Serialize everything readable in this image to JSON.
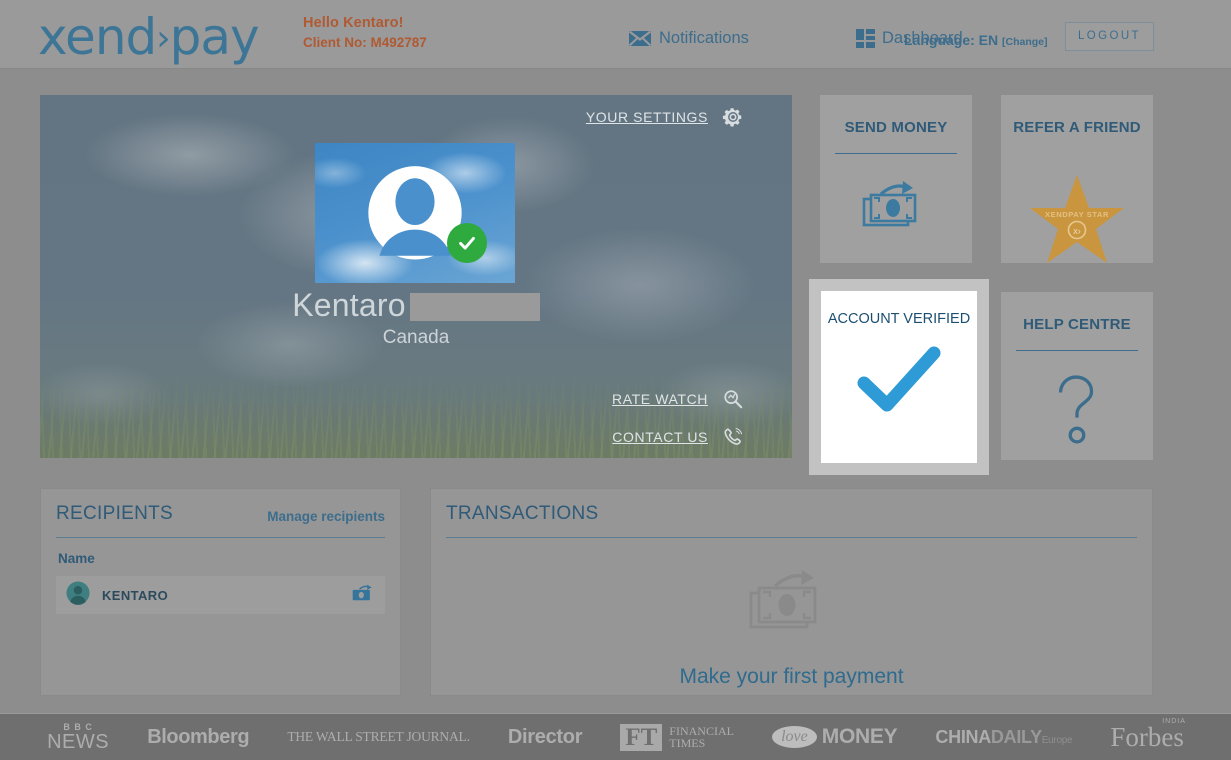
{
  "header": {
    "logo_text": "xend",
    "logo_chevron": "›",
    "logo_text2": "pay",
    "greeting": "Hello Kentaro!",
    "client_no": "Client No: M492787",
    "nav": [
      {
        "label": "Notifications",
        "icon": "envelope-icon"
      },
      {
        "label": "Dashboard",
        "icon": "dashboard-grid-icon"
      }
    ],
    "language_label": "Language: EN",
    "language_change": "[Change]",
    "logout_label": "LOGOUT"
  },
  "hero": {
    "settings_label": "YOUR SETTINGS",
    "settings_icon": "gear-icon",
    "profile_name": "Kentaro",
    "profile_name_redacted": "",
    "profile_country": "Canada",
    "avatar_icon": "user-silhouette-icon",
    "verified_badge_icon": "green-check-badge-icon",
    "links": [
      {
        "label": "RATE WATCH",
        "icon": "magnifier-icon"
      },
      {
        "label": "CONTACT US",
        "icon": "phone-icon"
      }
    ]
  },
  "tiles": {
    "send_money": {
      "title": "SEND MONEY",
      "icon": "banknote-arrow-icon"
    },
    "refer_friend": {
      "title": "REFER A FRIEND",
      "icon": "star-icon",
      "star_text": "XENDPAY STAR",
      "star_mark": "x›"
    },
    "account_verified": {
      "title": "ACCOUNT VERIFIED",
      "icon": "blue-checkmark-icon"
    },
    "help_centre": {
      "title": "HELP CENTRE",
      "icon": "question-mark-icon"
    }
  },
  "recipients": {
    "title": "RECIPIENTS",
    "manage_link": "Manage recipients",
    "columns": [
      "Name"
    ],
    "rows": [
      {
        "name": "KENTARO",
        "avatar_icon": "contact-avatar-icon",
        "action_icon": "send-money-small-icon"
      }
    ]
  },
  "transactions": {
    "title": "TRANSACTIONS",
    "empty_icon": "banknote-arrow-icon",
    "empty_cta": "Make your first payment"
  },
  "footer": {
    "press": [
      {
        "name": "bbc-news-logo",
        "line1": "B B C",
        "line2": "NEWS"
      },
      {
        "name": "bloomberg-logo",
        "text": "Bloomberg"
      },
      {
        "name": "wall-street-journal-logo",
        "text": "THE WALL STREET JOURNAL."
      },
      {
        "name": "director-logo",
        "text": "Director"
      },
      {
        "name": "financial-times-logo",
        "mark": "FT",
        "line1": "FINANCIAL",
        "line2": "TIMES"
      },
      {
        "name": "love-money-logo",
        "mark": "love",
        "text": "MONEY"
      },
      {
        "name": "china-daily-logo",
        "text1": "CHINA",
        "text2": "DAILY",
        "text3": "Europe"
      },
      {
        "name": "forbes-logo",
        "text": "Forbes",
        "sup": "INDIA"
      }
    ]
  },
  "colors": {
    "page_bg": "#8d8d8d",
    "header_bg": "#9a9a9a",
    "brand_blue": "#3d7596",
    "accent_orange": "#b05a33",
    "link_blue": "#3d6d8c",
    "title_blue": "#2f5a78",
    "verify_green": "#2eaa3f",
    "star_gold": "#c9963f",
    "check_blue": "#2e9bd6",
    "footer_bg": "#6f6f6f"
  }
}
